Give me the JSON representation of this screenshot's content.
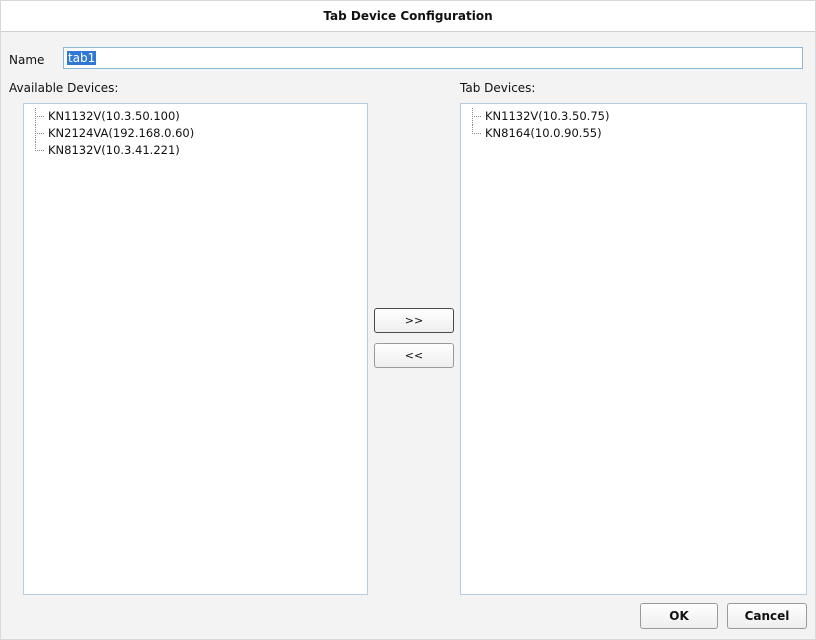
{
  "dialog": {
    "title": "Tab Device Configuration"
  },
  "name": {
    "label": "Name",
    "value": "tab1"
  },
  "available": {
    "label": "Available Devices:",
    "items": [
      "KN1132V(10.3.50.100)",
      "KN2124VA(192.168.0.60)",
      "KN8132V(10.3.41.221)"
    ]
  },
  "tab_devices": {
    "label": "Tab Devices:",
    "items": [
      "KN1132V(10.3.50.75)",
      "KN8164(10.0.90.55)"
    ]
  },
  "actions": {
    "add_label": ">>",
    "remove_label": "<<"
  },
  "footer": {
    "ok_label": "OK",
    "cancel_label": "Cancel"
  }
}
